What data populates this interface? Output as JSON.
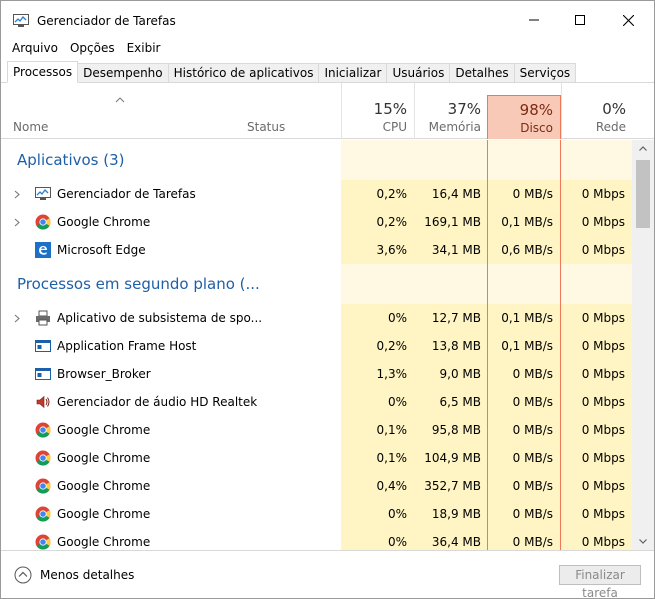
{
  "window": {
    "title": "Gerenciador de Tarefas"
  },
  "menu": [
    "Arquivo",
    "Opções",
    "Exibir"
  ],
  "tabs": [
    "Processos",
    "Desempenho",
    "Histórico de aplicativos",
    "Inicializar",
    "Usuários",
    "Detalhes",
    "Serviços"
  ],
  "header": {
    "name": "Nome",
    "status": "Status",
    "cpu": {
      "pct": "15%",
      "label": "CPU"
    },
    "memory": {
      "pct": "37%",
      "label": "Memória"
    },
    "disk": {
      "pct": "98%",
      "label": "Disco"
    },
    "network": {
      "pct": "0%",
      "label": "Rede"
    }
  },
  "groups": {
    "apps": "Aplicativos (3)",
    "background": "Processos em segundo plano (..."
  },
  "apps": [
    {
      "name": "Gerenciador de Tarefas",
      "cpu": "0,2%",
      "mem": "16,4 MB",
      "disk": "0 MB/s",
      "net": "0 Mbps",
      "icon": "task-manager-icon",
      "expandable": true
    },
    {
      "name": "Google Chrome",
      "cpu": "0,2%",
      "mem": "169,1 MB",
      "disk": "0,1 MB/s",
      "net": "0 Mbps",
      "icon": "chrome-icon",
      "expandable": true
    },
    {
      "name": "Microsoft Edge",
      "cpu": "3,6%",
      "mem": "34,1 MB",
      "disk": "0,6 MB/s",
      "net": "0 Mbps",
      "icon": "edge-icon",
      "expandable": false
    }
  ],
  "background": [
    {
      "name": "Aplicativo de subsistema de spo...",
      "cpu": "0%",
      "mem": "12,7 MB",
      "disk": "0,1 MB/s",
      "net": "0 Mbps",
      "icon": "printer-icon",
      "expandable": true
    },
    {
      "name": "Application Frame Host",
      "cpu": "0,2%",
      "mem": "13,8 MB",
      "disk": "0,1 MB/s",
      "net": "0 Mbps",
      "icon": "app-frame-icon",
      "expandable": false
    },
    {
      "name": "Browser_Broker",
      "cpu": "1,3%",
      "mem": "9,0 MB",
      "disk": "0 MB/s",
      "net": "0 Mbps",
      "icon": "app-frame-icon",
      "expandable": false
    },
    {
      "name": "Gerenciador de áudio HD Realtek",
      "cpu": "0%",
      "mem": "6,5 MB",
      "disk": "0 MB/s",
      "net": "0 Mbps",
      "icon": "speaker-icon",
      "expandable": false
    },
    {
      "name": "Google Chrome",
      "cpu": "0,1%",
      "mem": "95,8 MB",
      "disk": "0 MB/s",
      "net": "0 Mbps",
      "icon": "chrome-icon",
      "expandable": false
    },
    {
      "name": "Google Chrome",
      "cpu": "0,1%",
      "mem": "104,9 MB",
      "disk": "0 MB/s",
      "net": "0 Mbps",
      "icon": "chrome-icon",
      "expandable": false
    },
    {
      "name": "Google Chrome",
      "cpu": "0,4%",
      "mem": "352,7 MB",
      "disk": "0 MB/s",
      "net": "0 Mbps",
      "icon": "chrome-icon",
      "expandable": false
    },
    {
      "name": "Google Chrome",
      "cpu": "0%",
      "mem": "18,9 MB",
      "disk": "0 MB/s",
      "net": "0 Mbps",
      "icon": "chrome-icon",
      "expandable": false
    },
    {
      "name": "Google Chrome",
      "cpu": "0%",
      "mem": "36,4 MB",
      "disk": "0 MB/s",
      "net": "0 Mbps",
      "icon": "chrome-icon",
      "expandable": false
    }
  ],
  "footer": {
    "less_details": "Menos detalhes",
    "end_task": "Finalizar tarefa"
  },
  "colors": {
    "group_title": "#1f5fa8",
    "cell_highlight": "#fff4c4",
    "disk_header": "#f9c9b7",
    "disk_border": "#f0785a"
  }
}
